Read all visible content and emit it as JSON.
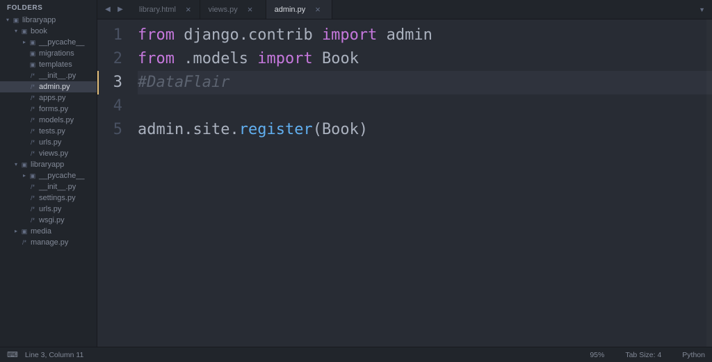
{
  "sidebar": {
    "header": "FOLDERS",
    "tree": [
      {
        "depth": 0,
        "arrow": "▾",
        "icon": "folder",
        "label": "libraryapp"
      },
      {
        "depth": 1,
        "arrow": "▾",
        "icon": "folder",
        "label": "book"
      },
      {
        "depth": 2,
        "arrow": "▸",
        "icon": "folder",
        "label": "__pycache__"
      },
      {
        "depth": 2,
        "arrow": "",
        "icon": "folder",
        "label": "migrations"
      },
      {
        "depth": 2,
        "arrow": "",
        "icon": "folder",
        "label": "templates"
      },
      {
        "depth": 2,
        "arrow": "",
        "icon": "file",
        "label": "__init__.py"
      },
      {
        "depth": 2,
        "arrow": "",
        "icon": "file",
        "label": "admin.py",
        "selected": true
      },
      {
        "depth": 2,
        "arrow": "",
        "icon": "file",
        "label": "apps.py"
      },
      {
        "depth": 2,
        "arrow": "",
        "icon": "file",
        "label": "forms.py"
      },
      {
        "depth": 2,
        "arrow": "",
        "icon": "file",
        "label": "models.py"
      },
      {
        "depth": 2,
        "arrow": "",
        "icon": "file",
        "label": "tests.py"
      },
      {
        "depth": 2,
        "arrow": "",
        "icon": "file",
        "label": "urls.py"
      },
      {
        "depth": 2,
        "arrow": "",
        "icon": "file",
        "label": "views.py"
      },
      {
        "depth": 1,
        "arrow": "▾",
        "icon": "folder",
        "label": "libraryapp"
      },
      {
        "depth": 2,
        "arrow": "▸",
        "icon": "folder",
        "label": "__pycache__"
      },
      {
        "depth": 2,
        "arrow": "",
        "icon": "file",
        "label": "__init__.py"
      },
      {
        "depth": 2,
        "arrow": "",
        "icon": "file",
        "label": "settings.py"
      },
      {
        "depth": 2,
        "arrow": "",
        "icon": "file",
        "label": "urls.py"
      },
      {
        "depth": 2,
        "arrow": "",
        "icon": "file",
        "label": "wsgi.py"
      },
      {
        "depth": 1,
        "arrow": "▸",
        "icon": "folder",
        "label": "media"
      },
      {
        "depth": 1,
        "arrow": "",
        "icon": "file",
        "label": "manage.py"
      }
    ]
  },
  "tabs": [
    {
      "label": "library.html",
      "active": false
    },
    {
      "label": "views.py",
      "active": false
    },
    {
      "label": "admin.py",
      "active": true
    }
  ],
  "code": {
    "lines": [
      {
        "n": 1,
        "active": false,
        "tokens": [
          [
            "kw",
            "from"
          ],
          [
            "sp",
            " "
          ],
          [
            "mod",
            "django"
          ],
          [
            "op",
            "."
          ],
          [
            "mod",
            "contrib"
          ],
          [
            "sp",
            " "
          ],
          [
            "kw",
            "import"
          ],
          [
            "sp",
            " "
          ],
          [
            "name",
            "admin"
          ]
        ]
      },
      {
        "n": 2,
        "active": false,
        "tokens": [
          [
            "kw",
            "from"
          ],
          [
            "sp",
            " "
          ],
          [
            "op",
            "."
          ],
          [
            "mod",
            "models"
          ],
          [
            "sp",
            " "
          ],
          [
            "kw",
            "import"
          ],
          [
            "sp",
            " "
          ],
          [
            "name",
            "Book"
          ]
        ]
      },
      {
        "n": 3,
        "active": true,
        "tokens": [
          [
            "cmt",
            "#DataFlair"
          ]
        ]
      },
      {
        "n": 4,
        "active": false,
        "tokens": []
      },
      {
        "n": 5,
        "active": false,
        "tokens": [
          [
            "name",
            "admin"
          ],
          [
            "op",
            "."
          ],
          [
            "name",
            "site"
          ],
          [
            "op",
            "."
          ],
          [
            "fn",
            "register"
          ],
          [
            "op",
            "("
          ],
          [
            "name",
            "Book"
          ],
          [
            "op",
            ")"
          ]
        ]
      }
    ]
  },
  "status": {
    "position": "Line 3, Column 11",
    "zoom": "95%",
    "tabsize": "Tab Size: 4",
    "lang": "Python"
  }
}
